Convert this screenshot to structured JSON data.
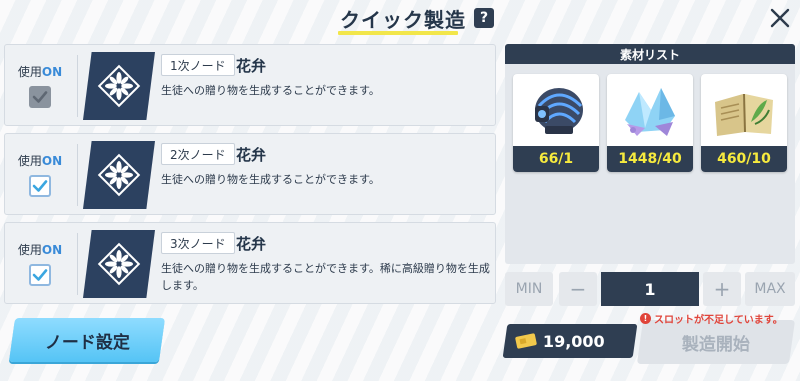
{
  "header": {
    "title": "クイック製造",
    "help_icon": "?"
  },
  "nodes": [
    {
      "use_label": "使用",
      "use_state": "ON",
      "checked": true,
      "enabled": false,
      "tier": "1次ノード",
      "name": "花弁",
      "description": "生徒への贈り物を生成することができます。"
    },
    {
      "use_label": "使用",
      "use_state": "ON",
      "checked": true,
      "enabled": true,
      "tier": "2次ノード",
      "name": "花弁",
      "description": "生徒への贈り物を生成することができます。"
    },
    {
      "use_label": "使用",
      "use_state": "ON",
      "checked": true,
      "enabled": true,
      "tier": "3次ノード",
      "name": "花弁",
      "description": "生徒への贈り物を生成することができます。稀に高級贈り物を生成します。"
    }
  ],
  "node_settings_label": "ノード設定",
  "materials": {
    "title": "素材リスト",
    "items": [
      {
        "icon": "robot-helmet-icon",
        "count": "66/1"
      },
      {
        "icon": "crystal-shards-icon",
        "count": "1448/40"
      },
      {
        "icon": "open-book-icon",
        "count": "460/10"
      }
    ]
  },
  "quantity": {
    "min_label": "MIN",
    "minus_label": "−",
    "value": "1",
    "plus_label": "+",
    "max_label": "MAX"
  },
  "warning": {
    "icon": "!",
    "text": "スロットが不足しています。"
  },
  "cost": {
    "icon": "credit-ticket-icon",
    "value": "19,000"
  },
  "craft_label": "製造開始",
  "colors": {
    "accent_blue": "#55c4f5",
    "navy": "#2f3e52",
    "count_yellow": "#f6ea3e",
    "warning_red": "#e0443a",
    "underline_yellow": "#f2e64a"
  }
}
